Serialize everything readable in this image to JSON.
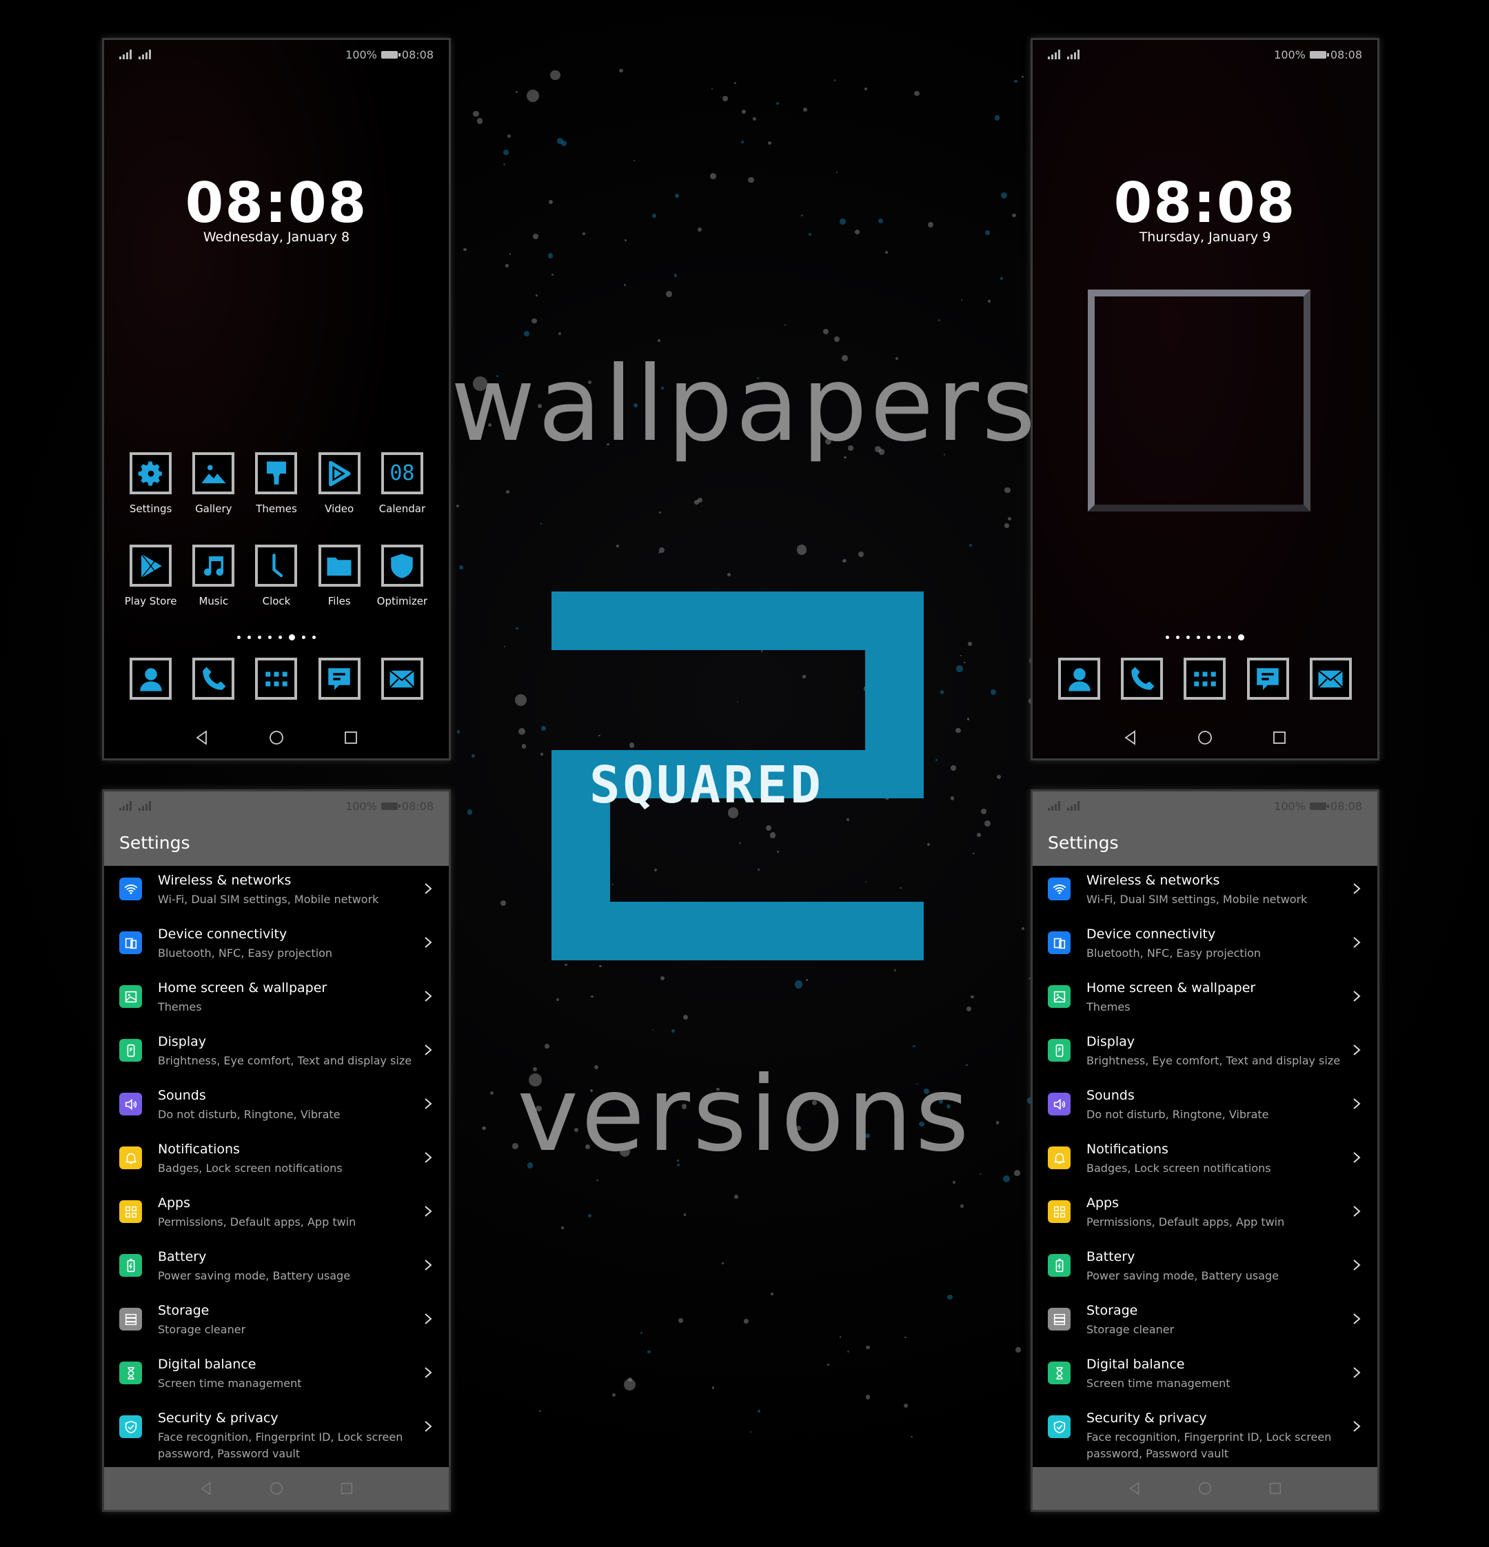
{
  "promo": {
    "title_top": "wallpapers",
    "logo_number": "2",
    "logo_text": "SQUARED",
    "title_bottom": "versions",
    "accent_color": "#1088b0"
  },
  "status_bar": {
    "battery": "100%",
    "time": "08:08"
  },
  "lockscreens": [
    {
      "time": "08:08",
      "date": "Wednesday, January 8",
      "page_count": 8,
      "active_page": 6,
      "apps_row1": [
        {
          "label": "Settings",
          "icon": "gear-icon"
        },
        {
          "label": "Gallery",
          "icon": "image-icon"
        },
        {
          "label": "Themes",
          "icon": "paintbrush-icon"
        },
        {
          "label": "Video",
          "icon": "play-icon"
        },
        {
          "label": "Calendar",
          "icon": "calendar-icon",
          "glyph": "08"
        }
      ],
      "apps_row2": [
        {
          "label": "Play Store",
          "icon": "play-store-icon"
        },
        {
          "label": "Music",
          "icon": "music-note-icon"
        },
        {
          "label": "Clock",
          "icon": "clock-icon"
        },
        {
          "label": "Files",
          "icon": "folder-icon"
        },
        {
          "label": "Optimizer",
          "icon": "shield-icon"
        }
      ],
      "dock": [
        "contacts-icon",
        "phone-icon",
        "app-drawer-icon",
        "messages-icon",
        "email-icon"
      ]
    },
    {
      "time": "08:08",
      "date": "Thursday, January 9",
      "page_count": 8,
      "active_page": 8,
      "dock": [
        "contacts-icon",
        "phone-icon",
        "app-drawer-icon",
        "messages-icon",
        "email-icon"
      ]
    }
  ],
  "settings": {
    "title": "Settings",
    "items": [
      {
        "title": "Wireless & networks",
        "subtitle": "Wi-Fi, Dual SIM settings, Mobile network",
        "icon": "wifi-icon",
        "color": "#1a7cf2"
      },
      {
        "title": "Device connectivity",
        "subtitle": "Bluetooth, NFC, Easy projection",
        "icon": "device-connectivity-icon",
        "color": "#1a7cf2"
      },
      {
        "title": "Home screen & wallpaper",
        "subtitle": "Themes",
        "icon": "wallpaper-icon",
        "color": "#1fbf78"
      },
      {
        "title": "Display",
        "subtitle": "Brightness, Eye comfort, Text and display size",
        "icon": "display-icon",
        "color": "#1fbf78"
      },
      {
        "title": "Sounds",
        "subtitle": "Do not disturb, Ringtone, Vibrate",
        "icon": "speaker-icon",
        "color": "#7a5ee8"
      },
      {
        "title": "Notifications",
        "subtitle": "Badges, Lock screen notifications",
        "icon": "bell-icon",
        "color": "#f5c518"
      },
      {
        "title": "Apps",
        "subtitle": "Permissions, Default apps, App twin",
        "icon": "apps-grid-icon",
        "color": "#f5c518"
      },
      {
        "title": "Battery",
        "subtitle": "Power saving mode, Battery usage",
        "icon": "battery-icon",
        "color": "#1fbf78"
      },
      {
        "title": "Storage",
        "subtitle": "Storage cleaner",
        "icon": "storage-icon",
        "color": "#8c8c8c"
      },
      {
        "title": "Digital balance",
        "subtitle": "Screen time management",
        "icon": "hourglass-icon",
        "color": "#1fbf78"
      },
      {
        "title": "Security & privacy",
        "subtitle": "Face recognition, Fingerprint ID, Lock screen password, Password vault",
        "icon": "shield-check-icon",
        "color": "#1fc4d4"
      }
    ]
  }
}
